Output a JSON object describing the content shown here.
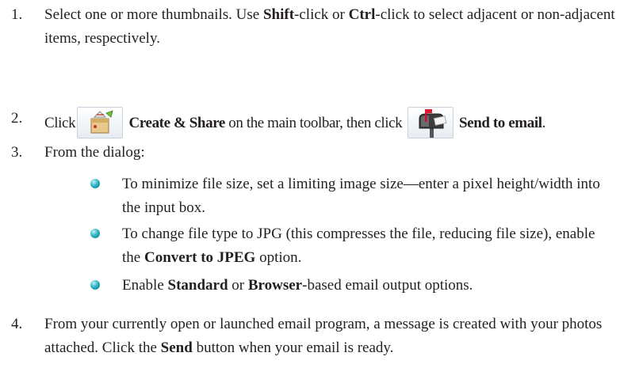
{
  "steps": [
    {
      "num": "1.",
      "parts": [
        {
          "t": "Select one or more thumbnails. Use "
        },
        {
          "t": "Shift",
          "b": true
        },
        {
          "t": "-click or "
        },
        {
          "t": "Ctrl",
          "b": true
        },
        {
          "t": "-click to select adjacent or non-adjacent items, respectively."
        }
      ]
    },
    {
      "num": "2.",
      "click_label": "Click",
      "create_share_label": "Create & Share",
      "middle_text": " on the main toolbar, then click",
      "send_email_label": "Send to email",
      "end_text": ".",
      "icons": [
        "create-share-icon",
        "mailbox-icon"
      ]
    },
    {
      "num": "3.",
      "text": "From the dialog:"
    },
    {
      "num": "4.",
      "parts": [
        {
          "t": "From your currently open or launched email program, a message is created with your photos attached. Click the "
        },
        {
          "t": "Send",
          "b": true
        },
        {
          "t": " button when your email is ready."
        }
      ]
    }
  ],
  "bullets": [
    {
      "parts": [
        {
          "t": "To minimize file size, set a limiting image size—enter a pixel height/width into the input box."
        }
      ]
    },
    {
      "parts": [
        {
          "t": "To change file type to JPG (this compresses the file, reducing file size), enable the "
        },
        {
          "t": "Convert to JPEG",
          "b": true
        },
        {
          "t": " option."
        }
      ]
    },
    {
      "parts": [
        {
          "t": "Enable "
        },
        {
          "t": "Standard",
          "b": true
        },
        {
          "t": " or "
        },
        {
          "t": "Browser",
          "b": true
        },
        {
          "t": "-based email output options."
        }
      ]
    }
  ],
  "colors": {
    "text": "#231f20",
    "bullet": "#2fb6c4"
  }
}
